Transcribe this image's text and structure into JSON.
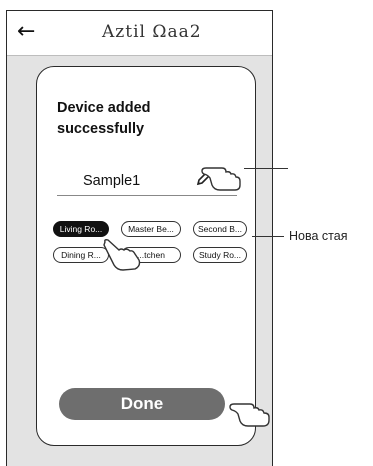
{
  "header": {
    "back_icon": "back-arrow-icon",
    "title": "Aztil Ωaa2"
  },
  "card": {
    "heading": "Device added successfully",
    "device_name": "Sample1",
    "edit_icon": "pencil-icon"
  },
  "rooms": [
    {
      "label": "Living Ro...",
      "selected": true
    },
    {
      "label": "Master Be...",
      "selected": false
    },
    {
      "label": "Second B...",
      "selected": false
    },
    {
      "label": "Dining R...",
      "selected": false
    },
    {
      "label": "...tchen",
      "selected": false
    },
    {
      "label": "Study Ro...",
      "selected": false
    }
  ],
  "actions": {
    "done_label": "Done"
  },
  "annotations": {
    "new_room_label": "Нова стая",
    "pointer_icon": "pointing-hand-icon"
  },
  "colors": {
    "frame_background": "#e3e3e3",
    "done_button": "#6e6e6e",
    "selected_chip": "#111111"
  }
}
